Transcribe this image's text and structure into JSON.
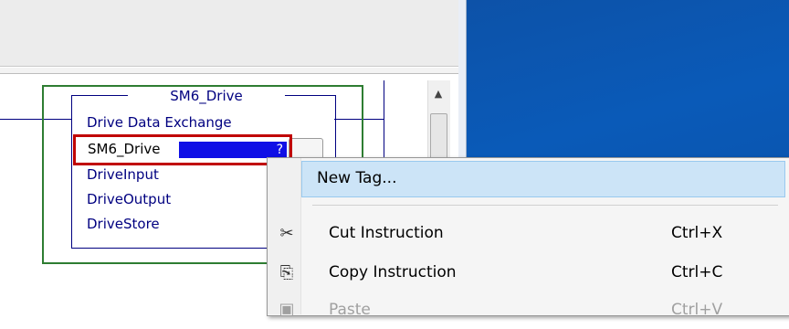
{
  "instruction": {
    "title": "SM6_Drive",
    "operands": [
      "Drive Data Exchange",
      "SM6_Drive",
      "DriveInput",
      "DriveOutput",
      "DriveStore"
    ],
    "tag_field_value": "?"
  },
  "context_menu": {
    "items": [
      {
        "label": "New Tag...",
        "shortcut": "",
        "icon": "",
        "state": "highlighted"
      },
      {
        "label": "Cut Instruction",
        "shortcut": "Ctrl+X",
        "icon": "scissors-icon",
        "state": "enabled"
      },
      {
        "label": "Copy Instruction",
        "shortcut": "Ctrl+C",
        "icon": "copy-icon",
        "state": "enabled"
      },
      {
        "label": "Paste",
        "shortcut": "Ctrl+V",
        "icon": "clipboard-icon",
        "state": "disabled"
      }
    ]
  },
  "colors": {
    "rung": "#000080",
    "highlight": "#c00000",
    "tag_field": "#1010e6",
    "menu_hover": "#cce4f7",
    "desktop": "#0a5ab8"
  }
}
